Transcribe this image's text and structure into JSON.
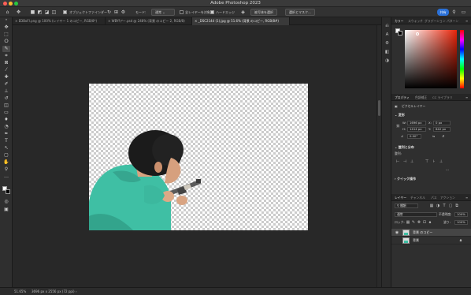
{
  "app": {
    "title": "Adobe Photoshop 2023"
  },
  "window_controls": {
    "close_color": "#ff5f57",
    "minimize_color": "#febc2e",
    "zoom_color": "#28c840"
  },
  "options_bar": {
    "auto_select_label": "オブジェクトファインダー",
    "mode_label": "モード:",
    "mode_value": "通常",
    "all_layers_label": "全レイヤーを対象",
    "hard_edge_label": "ハードエッジ",
    "select_subject_label": "被写体を選択",
    "select_mask_label": "選択とマスク...",
    "share_label": "共有"
  },
  "doc_tabs": [
    {
      "label": "EDBoFl.png @ 100% (レイヤー 1 のコピー, RGB/8*)",
      "active": false
    },
    {
      "label": "WBYfアー.psd @ 248% (背景 のコピー 2, RGB/8)",
      "active": false
    },
    {
      "label": "_DSC2144 (1).jpg @ 51.6% (背景 のコピー, RGB/8#)",
      "active": true
    }
  ],
  "toolbar": {
    "tools": [
      {
        "name": "move-tool",
        "glyph": "✥"
      },
      {
        "name": "marquee-tool",
        "glyph": "⬚"
      },
      {
        "name": "lasso-tool",
        "glyph": "ⵔ"
      },
      {
        "name": "quick-select-tool",
        "glyph": "✎"
      },
      {
        "name": "crop-tool",
        "glyph": "⌗"
      },
      {
        "name": "frame-tool",
        "glyph": "⊠"
      },
      {
        "name": "eyedropper-tool",
        "glyph": "⁄"
      },
      {
        "name": "healing-tool",
        "glyph": "✚"
      },
      {
        "name": "brush-tool",
        "glyph": "✐"
      },
      {
        "name": "stamp-tool",
        "glyph": "⊥"
      },
      {
        "name": "history-brush-tool",
        "glyph": "↺"
      },
      {
        "name": "eraser-tool",
        "glyph": "◫"
      },
      {
        "name": "gradient-tool",
        "glyph": "▭"
      },
      {
        "name": "blur-tool",
        "glyph": "♦"
      },
      {
        "name": "dodge-tool",
        "glyph": "◔"
      },
      {
        "name": "pen-tool",
        "glyph": "✒"
      },
      {
        "name": "type-tool",
        "glyph": "T"
      },
      {
        "name": "path-select-tool",
        "glyph": "↖"
      },
      {
        "name": "shape-tool",
        "glyph": "▢"
      },
      {
        "name": "hand-tool",
        "glyph": "✋"
      },
      {
        "name": "zoom-tool",
        "glyph": "⚲"
      },
      {
        "name": "more-tools",
        "glyph": "…"
      }
    ],
    "foreground_color": "#ffffff",
    "background_color": "#000000"
  },
  "side_strip": {
    "icons": [
      {
        "name": "history-icon",
        "glyph": "⎌"
      },
      {
        "name": "glyphs-icon",
        "glyph": "A"
      },
      {
        "name": "actions-icon",
        "glyph": "⚙"
      },
      {
        "name": "properties-icon",
        "glyph": "◧"
      },
      {
        "name": "adjust-icon",
        "glyph": "◑"
      }
    ]
  },
  "color_panel": {
    "tabs": [
      "カラー",
      "スウォッチ",
      "グラデーション",
      "パターン"
    ]
  },
  "properties_panel": {
    "tabs": [
      "プロパティ",
      "色調補正",
      "CC ライブラリ"
    ],
    "layer_type": "ピクセルレイヤー",
    "transform": {
      "heading": "変形",
      "w_label": "W:",
      "w_value": "1696 px",
      "x_label": "X:",
      "x_value": "0 px",
      "h_label": "H:",
      "h_value": "1414 px",
      "y_label": "Y:",
      "y_value": "642 px",
      "angle_value": "0.00°"
    },
    "align": {
      "heading": "整列と分布",
      "sub": "整列:"
    },
    "quick_actions": {
      "heading": "クイック操作"
    }
  },
  "layers_panel": {
    "tabs": [
      "レイヤー",
      "チャンネル",
      "パス",
      "アクション"
    ],
    "search_label": "種類",
    "blend_mode": "通常",
    "opacity_label": "不透明度:",
    "opacity_value": "100%",
    "lock_label": "ロック:",
    "fill_label": "塗り:",
    "fill_value": "100%",
    "layers": [
      {
        "name": "背景 のコピー",
        "visible": true,
        "active": true
      },
      {
        "name": "背景",
        "visible": false,
        "active": false
      }
    ]
  },
  "status_bar": {
    "zoom": "51.65%",
    "dimensions": "3696 px x 2556 px (72 ppi)"
  }
}
